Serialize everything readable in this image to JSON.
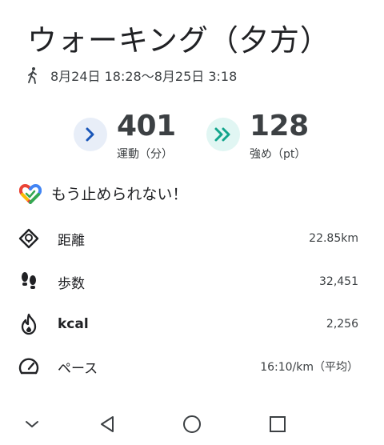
{
  "header": {
    "title": "ウォーキング（夕方）",
    "date_range": "8月24日 18:28〜8月25日 3:18",
    "activity_icon": "walking-person-icon"
  },
  "metrics": [
    {
      "value": "401",
      "unit": "運動（分）",
      "icon": "chevron-right-icon",
      "color": "#1a56b8"
    },
    {
      "value": "128",
      "unit": "強め（pt）",
      "icon": "double-chevron-right-icon",
      "color": "#12a58c"
    }
  ],
  "motto": {
    "text": "もう止められない！",
    "icon": "google-fit-heart-icon"
  },
  "stats": [
    {
      "label": "距離",
      "value": "22.85km",
      "icon": "diamond-route-icon"
    },
    {
      "label": "歩数",
      "value": "32,451",
      "icon": "footprints-icon"
    },
    {
      "label": "kcal",
      "value": "2,256",
      "icon": "flame-icon"
    },
    {
      "label": "ペース",
      "value": "16:10/km（平均）",
      "icon": "speedometer-icon"
    }
  ],
  "navbar": {
    "icons": [
      "collapse-chevron-icon",
      "back-triangle-icon",
      "home-circle-icon",
      "recents-square-icon"
    ]
  },
  "colors": {
    "text": "#202124",
    "secondary": "#3c4043",
    "move_blue": "#1a56b8",
    "heart_teal": "#12a58c"
  }
}
